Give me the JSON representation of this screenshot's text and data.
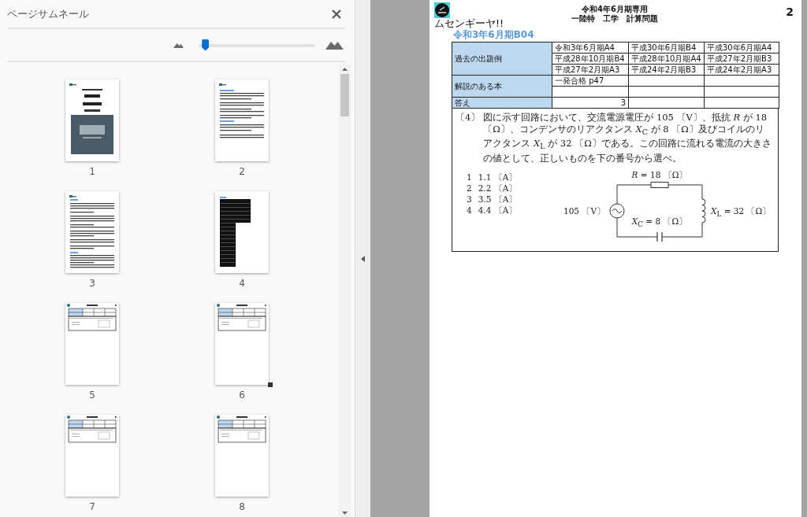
{
  "thumbnail_panel": {
    "title": "ページサムネール",
    "zoom_slider": {
      "level": 0.03
    },
    "thumbnails": [
      {
        "label": "1",
        "kind": "cover",
        "marker": false
      },
      {
        "label": "2",
        "kind": "notes",
        "marker": false
      },
      {
        "label": "3",
        "kind": "text",
        "marker": false
      },
      {
        "label": "4",
        "kind": "table",
        "marker": false
      },
      {
        "label": "5",
        "kind": "problem",
        "marker": false
      },
      {
        "label": "6",
        "kind": "problem",
        "marker": true
      },
      {
        "label": "7",
        "kind": "problem",
        "marker": false
      },
      {
        "label": "8",
        "kind": "problem",
        "marker": false
      }
    ]
  },
  "document": {
    "logo_text": "ムセンギーヤ!!",
    "header_lines": [
      "令和4年6月期専用",
      "一陸特　工学　計算問題"
    ],
    "page_number": "2",
    "section_title": "令和3年6月期B04",
    "info_table": {
      "groups": [
        {
          "kind": "list",
          "label": "過去の出題例",
          "rows": [
            [
              "令和3年6月期A4",
              "平成30年6月期B4",
              "平成30年6月期A4"
            ],
            [
              "平成28年10月期B4",
              "平成28年10月期A4",
              "平成27年2月期B3"
            ],
            [
              "平成27年2月期A3",
              "平成24年2月期B3",
              "平成24年2月期A3"
            ]
          ]
        },
        {
          "kind": "list",
          "label": "解説のある本",
          "rows": [
            [
              "一発合格 p47",
              null,
              null
            ],
            [
              null,
              null,
              null
            ]
          ]
        },
        {
          "kind": "answer",
          "label": "答え",
          "rows": [
            [
              "3",
              null,
              null
            ]
          ]
        }
      ]
    },
    "question": {
      "number": "〔4〕",
      "text": "図に示す回路において、交流電源電圧が 105 〔V〕、抵抗 *R* が 18 〔Ω〕、コンデンサのリアクタンス *X*$_{C}$ が 8 〔Ω〕及びコイルのリアクタンス *X*$_{L}$ が 32 〔Ω〕である。この回路に流れる電流の大きさの値として、正しいものを下の番号から選べ。",
      "options": [
        {
          "number": "1",
          "value": "1.1 〔A〕"
        },
        {
          "number": "2",
          "value": "2.2 〔A〕"
        },
        {
          "number": "3",
          "value": "3.5 〔A〕"
        },
        {
          "number": "4",
          "value": "4.4 〔A〕"
        }
      ],
      "circuit": {
        "resistor_label": "*R* = 18 〔Ω〕",
        "source_label": "105 〔V〕",
        "capacitor_label": "*X*$_{C}$ = 8 〔Ω〕",
        "inductor_label": "*X*$_{L}$ = 32 〔Ω〕"
      }
    }
  }
}
